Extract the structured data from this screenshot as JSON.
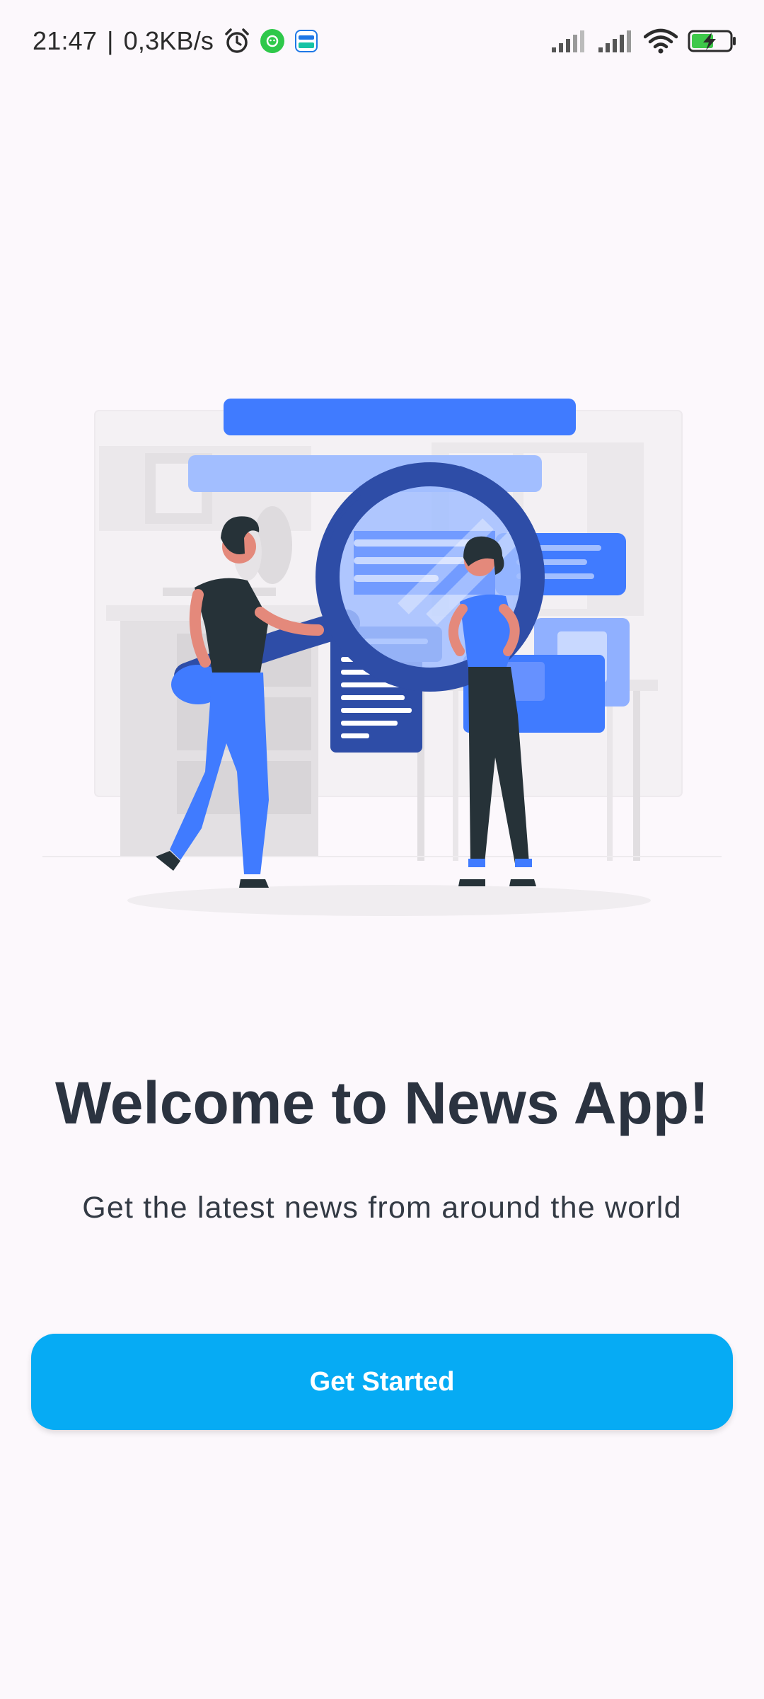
{
  "status_bar": {
    "time": "21:47",
    "separator": "|",
    "network_speed": "0,3KB/s",
    "icons": [
      "alarm-icon",
      "app-icon-green",
      "zalo-pay-icon",
      "signal-icon",
      "signal-icon",
      "wifi-icon",
      "battery-charging-icon"
    ]
  },
  "welcome": {
    "title": "Welcome to News App!",
    "subtitle": "Get the latest news from around the world",
    "cta_label": "Get Started"
  },
  "colors": {
    "background": "#FCF8FC",
    "primary_button": "#06ABF4",
    "illustration_blue": "#407BFF",
    "illustration_dark": "#263238",
    "title_text": "#2B3340"
  }
}
